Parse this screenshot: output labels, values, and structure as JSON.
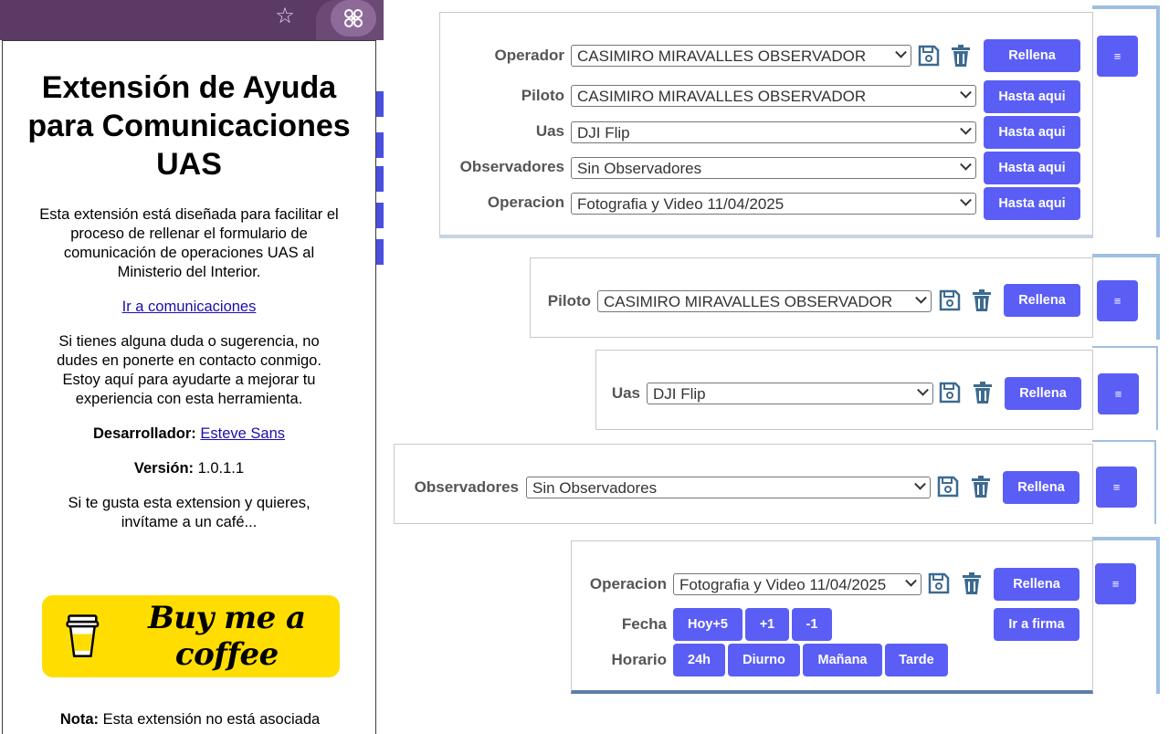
{
  "popup": {
    "title": "Extensión de Ayuda para Comunicaciones UAS",
    "description": "Esta extensión está diseñada para facilitar el proceso de rellenar el formulario de comunicación de operaciones UAS al Ministerio del Interior.",
    "link_text": "Ir a comunicaciones",
    "doubts_text": "Si tienes alguna duda o sugerencia, no dudes en ponerte en contacto conmigo. Estoy aquí para ayudarte a mejorar tu experiencia con esta herramienta.",
    "developer_label": "Desarrollador:",
    "developer_name": "Esteve Sans",
    "version_label": "Versión:",
    "version_value": "1.0.1.1",
    "coffee_text": "Si te gusta esta extension y quieres, invítame a un café...",
    "bmc_label": "Buy me a coffee",
    "note_label": "Nota:",
    "note_text": "Esta extensión no está asociada"
  },
  "main_panel": {
    "rows": [
      {
        "label": "Operador",
        "value": "CASIMIRO MIRAVALLES OBSERVADOR",
        "button": "Rellena"
      },
      {
        "label": "Piloto",
        "value": "CASIMIRO MIRAVALLES OBSERVADOR",
        "button": "Hasta aqui"
      },
      {
        "label": "Uas",
        "value": "DJI Flip",
        "button": "Hasta aqui"
      },
      {
        "label": "Observadores",
        "value": "Sin Observadores",
        "button": "Hasta aqui"
      },
      {
        "label": "Operacion",
        "value": "Fotografia y Video 11/04/2025",
        "button": "Hasta aqui"
      }
    ],
    "menu": "≡"
  },
  "piloto_panel": {
    "label": "Piloto",
    "value": "CASIMIRO MIRAVALLES OBSERVADOR",
    "button": "Rellena",
    "menu": "≡"
  },
  "uas_panel": {
    "label": "Uas",
    "value": "DJI Flip",
    "button": "Rellena",
    "menu": "≡"
  },
  "observadores_panel": {
    "label": "Observadores",
    "value": "Sin Observadores",
    "button": "Rellena",
    "menu": "≡"
  },
  "operacion_panel": {
    "label": "Operacion",
    "value": "Fotografia y Video 11/04/2025",
    "button": "Rellena",
    "menu": "≡",
    "fecha_label": "Fecha",
    "fecha_buttons": [
      "Hoy+5",
      "+1",
      "-1"
    ],
    "horario_label": "Horario",
    "horario_buttons": [
      "24h",
      "Diurno",
      "Mañana",
      "Tarde"
    ],
    "firma_button": "Ir a firma"
  },
  "colors": {
    "accent": "#5a5ef5",
    "chrome": "#5b3a66",
    "bmc_yellow": "#ffdd00",
    "icon": "#3d6a8f"
  }
}
